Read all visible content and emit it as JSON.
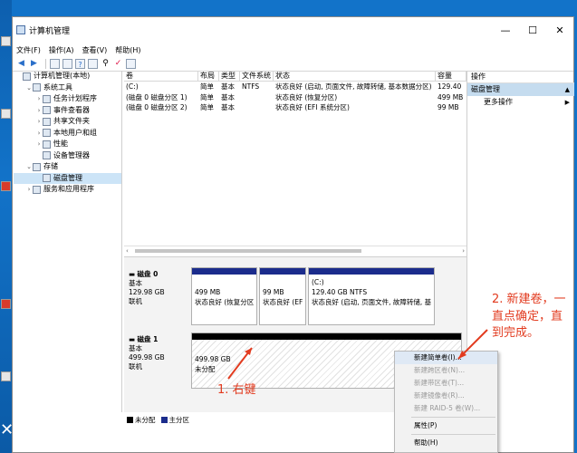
{
  "window": {
    "title": "计算机管理"
  },
  "controls": {
    "minimize": "—",
    "maximize": "☐",
    "close": "✕"
  },
  "menu": [
    "文件(F)",
    "操作(A)",
    "查看(V)",
    "帮助(H)"
  ],
  "tree": [
    {
      "label": "计算机管理(本地)",
      "indent": 0,
      "arrow": ""
    },
    {
      "label": "系统工具",
      "indent": 1,
      "arrow": "v"
    },
    {
      "label": "任务计划程序",
      "indent": 2,
      "arrow": ">"
    },
    {
      "label": "事件查看器",
      "indent": 2,
      "arrow": ">"
    },
    {
      "label": "共享文件夹",
      "indent": 2,
      "arrow": ">"
    },
    {
      "label": "本地用户和组",
      "indent": 2,
      "arrow": ">"
    },
    {
      "label": "性能",
      "indent": 2,
      "arrow": ">"
    },
    {
      "label": "设备管理器",
      "indent": 2,
      "arrow": ""
    },
    {
      "label": "存储",
      "indent": 1,
      "arrow": "v"
    },
    {
      "label": "磁盘管理",
      "indent": 2,
      "arrow": "",
      "selected": true
    },
    {
      "label": "服务和应用程序",
      "indent": 1,
      "arrow": ">"
    }
  ],
  "volume_table": {
    "headers": [
      "卷",
      "布局",
      "类型",
      "文件系统",
      "状态",
      "容量"
    ],
    "rows": [
      [
        "(C:)",
        "简单",
        "基本",
        "NTFS",
        "状态良好 (启动, 页面文件, 故障转储, 基本数据分区)",
        "129.40"
      ],
      [
        "(磁盘 0 磁盘分区 1)",
        "简单",
        "基本",
        "",
        "状态良好 (恢复分区)",
        "499 MB"
      ],
      [
        "(磁盘 0 磁盘分区 2)",
        "简单",
        "基本",
        "",
        "状态良好 (EFI 系统分区)",
        "99 MB"
      ]
    ]
  },
  "disk0": {
    "name": "磁盘 0",
    "type": "基本",
    "size": "129.98 GB",
    "status": "联机",
    "partitions": [
      {
        "line1": "",
        "line2": "499 MB",
        "line3": "状态良好 (恢复分区"
      },
      {
        "line1": "",
        "line2": "99 MB",
        "line3": "状态良好 (EF"
      },
      {
        "line1": "(C:)",
        "line2": "129.40 GB NTFS",
        "line3": "状态良好 (启动, 页面文件, 故障转储, 基"
      }
    ]
  },
  "disk1": {
    "name": "磁盘 1",
    "type": "基本",
    "size": "499.98 GB",
    "status": "联机",
    "partition": {
      "line1": "499.98 GB",
      "line2": "未分配"
    }
  },
  "legend": {
    "unallocated": "未分配",
    "primary": "主分区"
  },
  "actions": {
    "header": "操作",
    "section": "磁盘管理",
    "more": "更多操作"
  },
  "context_menu": [
    {
      "label": "新建简单卷(I)...",
      "disabled": false,
      "highlight": true
    },
    {
      "label": "新建跨区卷(N)...",
      "disabled": true
    },
    {
      "label": "新建带区卷(T)...",
      "disabled": true
    },
    {
      "label": "新建镜像卷(R)...",
      "disabled": true
    },
    {
      "label": "新建 RAID-5 卷(W)...",
      "disabled": true
    },
    {
      "sep": true
    },
    {
      "label": "属性(P)",
      "disabled": false
    },
    {
      "sep": true
    },
    {
      "label": "帮助(H)",
      "disabled": false
    }
  ],
  "annotations": {
    "step1": "1. 右键",
    "step2_l1": "2. 新建卷，一",
    "step2_l2": "直点确定，直",
    "step2_l3": "到完成。"
  },
  "colors": {
    "primary_partition": "#1b2c8c",
    "annotation": "#e23b1f",
    "selection": "#cce4f7"
  }
}
